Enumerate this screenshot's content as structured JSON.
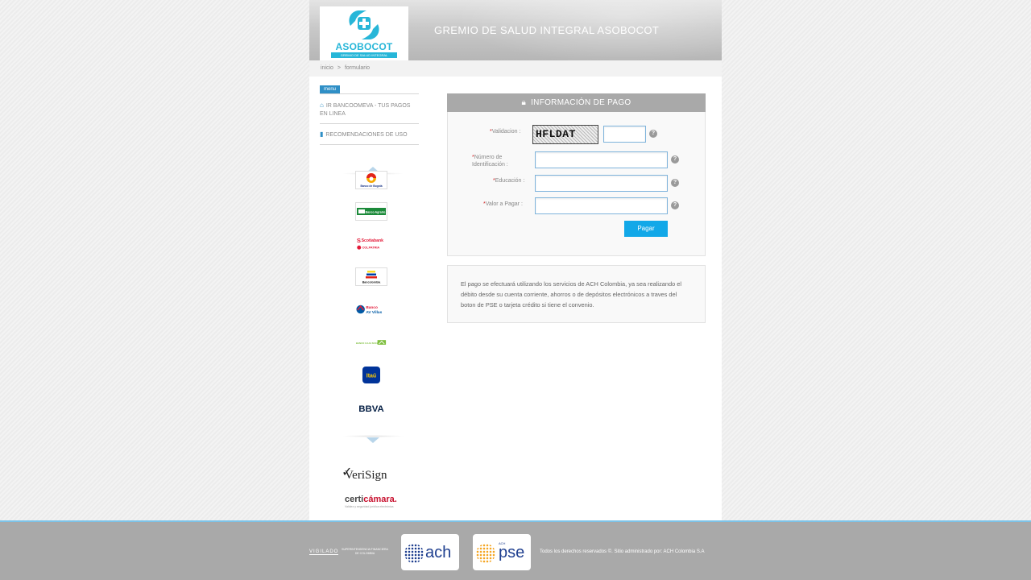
{
  "header": {
    "logo_name": "ASOBOCOT",
    "logo_subtitle": "GREMIO DE SALUD INTEGRAL",
    "site_title": "GREMIO DE SALUD INTEGRAL ASOBOCOT"
  },
  "breadcrumb": {
    "home": "inicio",
    "separator": ">",
    "current": "formulario"
  },
  "sidebar": {
    "menu_label": "menu",
    "items": [
      {
        "label": "IR BANCOOMEVA - TUS PAGOS EN LINEA",
        "icon": "home-icon"
      },
      {
        "label": "RECOMENDACIONES DE USO",
        "icon": "document-icon"
      }
    ],
    "banks": [
      {
        "name": "Banco de Bogotá",
        "label": "Banco de Bogotá"
      },
      {
        "name": "Banco Agrario",
        "label": "Banco Agrario"
      },
      {
        "name": "Scotiabank Colpatria",
        "label": "Scotiabank",
        "label2": "COLPATRIA"
      },
      {
        "name": "Bancolombia",
        "label": "Bancolombia"
      },
      {
        "name": "Banco AV Villas",
        "label": "Banco",
        "label2": "AV Villas"
      },
      {
        "name": "Banco Caja Social",
        "label": "BANCO CAJA SOCIAL"
      },
      {
        "name": "Itaú",
        "label": "Itaú"
      },
      {
        "name": "BBVA",
        "label": "BBVA"
      }
    ],
    "seal_verisign": "VeriSign",
    "seal_certicamara_a": "certi",
    "seal_certicamara_b": "cámara.",
    "seal_certicamara_tag": "Validez y seguridad jurídica electrónica"
  },
  "payment": {
    "title": "INFORMACIÓN DE PAGO",
    "fields": {
      "validation_label": "Validacion :",
      "captcha_text": "HFLDAT",
      "id_label_line1": "Número de",
      "id_label_line2": "Identificación :",
      "education_label": "Educación :",
      "amount_label": "Valor a Pagar :",
      "required_mark": "*"
    },
    "help_glyph": "?",
    "submit_label": "Pagar",
    "info_text": "El pago se efectuará utilizando los servicios de ACH Colombia, ya sea realizando el débito desde su cuenta corriente, ahorros o de depósitos electrónicos a traves del boton de PSE o tarjeta crédito si tiene el convenio."
  },
  "footer": {
    "vigilado": "VIGILADO",
    "superintendencia": "SUPERINTENDENCIA FINANCIERA DE COLOMBIA",
    "ach_logo": "ach",
    "pse_logo": "pse",
    "pse_small": "ACH",
    "copyright": "Todos los derechos reservados ©. Sitio administrado por: ACH Colombia S.A"
  },
  "colors": {
    "accent": "#12a8e8",
    "brand": "#27b6d8",
    "header_gray": "#a9a9a9"
  }
}
